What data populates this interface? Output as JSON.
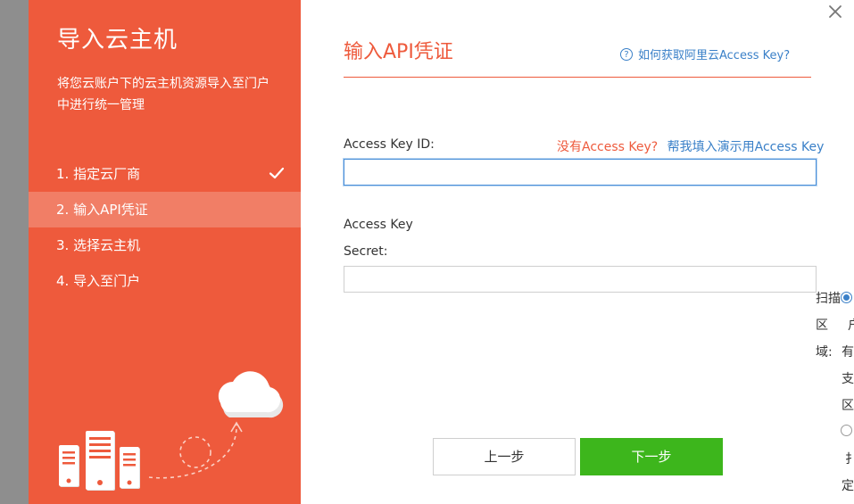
{
  "sidebar": {
    "title": "导入云主机",
    "description": "将您云账户下的云主机资源导入至门户中进行统一管理",
    "steps": [
      {
        "label": "1. 指定云厂商",
        "done": true
      },
      {
        "label": "2. 输入API凭证",
        "active": true
      },
      {
        "label": "3. 选择云主机"
      },
      {
        "label": "4. 导入至门户"
      }
    ]
  },
  "main": {
    "title": "输入API凭证",
    "help_link": "如何获取阿里云Access Key?",
    "help_icon": "?",
    "key_id_label": "Access Key ID:",
    "no_key_link": "没有Access Key?",
    "demo_link": "帮我填入演示用Access Key",
    "key_id_value": "",
    "secret_label_line1": "Access Key",
    "secret_label_line2": "Secret:",
    "secret_value": "",
    "prev_button": "上一步",
    "next_button": "下一步",
    "scan_region_label": [
      "扫描",
      "区",
      "域:"
    ],
    "scan_option_text": [
      "户",
      "有",
      "支",
      "区",
      "扌",
      "定"
    ]
  },
  "colors": {
    "brand": "#ee5a3c",
    "link": "#3a80c8",
    "primary_button": "#3db61c"
  }
}
